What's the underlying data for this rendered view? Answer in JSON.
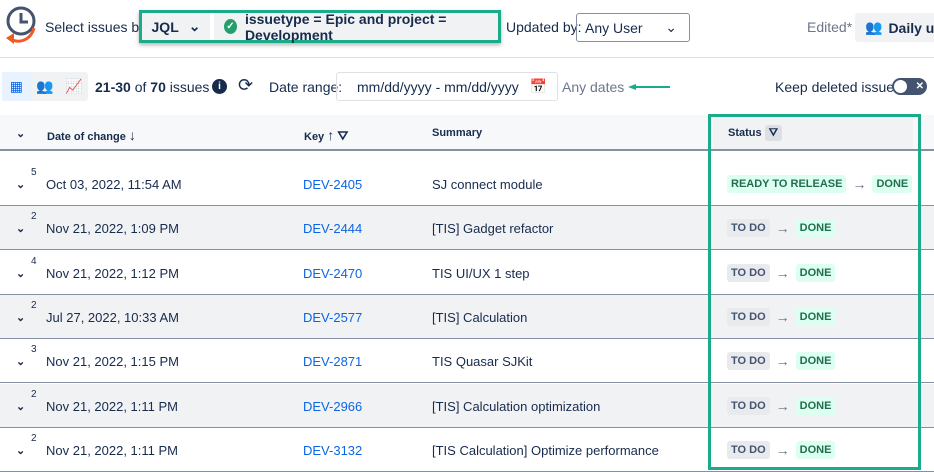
{
  "header": {
    "select_label": "Select issues by:",
    "mode": "JQL",
    "query": "issuetype = Epic and project = Development",
    "updated_by_label": "Updated by:",
    "updated_by_value": "Any User",
    "edited": "Edited*",
    "view_name": "Daily updates"
  },
  "toolbar": {
    "range": "21-30",
    "of": " of ",
    "total": "70",
    "issues": " issues",
    "date_range_label": "Date range:",
    "date_placeholder": "mm/dd/yyyy - mm/dd/yyyy",
    "any_dates": "Any dates",
    "keep_deleted": "Keep deleted issues"
  },
  "columns": {
    "date": "Date of change",
    "key": "Key",
    "summary": "Summary",
    "status": "Status"
  },
  "rows": [
    {
      "count": "5",
      "date": "Oct 03, 2022, 11:54 AM",
      "key": "DEV-2405",
      "summary": "SJ connect module",
      "from": "READY TO RELEASE",
      "to": "DONE"
    },
    {
      "count": "2",
      "date": "Nov 21, 2022, 1:09 PM",
      "key": "DEV-2444",
      "summary": "[TIS] Gadget refactor",
      "from": "TO DO",
      "to": "DONE"
    },
    {
      "count": "4",
      "date": "Nov 21, 2022, 1:12 PM",
      "key": "DEV-2470",
      "summary": "TIS UI/UX 1 step",
      "from": "TO DO",
      "to": "DONE"
    },
    {
      "count": "2",
      "date": "Jul 27, 2022, 10:33 AM",
      "key": "DEV-2577",
      "summary": "[TIS] Calculation",
      "from": "TO DO",
      "to": "DONE"
    },
    {
      "count": "3",
      "date": "Nov 21, 2022, 1:15 PM",
      "key": "DEV-2871",
      "summary": "TIS Quasar SJKit",
      "from": "TO DO",
      "to": "DONE"
    },
    {
      "count": "2",
      "date": "Nov 21, 2022, 1:11 PM",
      "key": "DEV-2966",
      "summary": "[TIS] Calculation optimization",
      "from": "TO DO",
      "to": "DONE"
    },
    {
      "count": "2",
      "date": "Nov 21, 2022, 1:11 PM",
      "key": "DEV-3132",
      "summary": "[TIS Calculation] Optimize performance",
      "from": "TO DO",
      "to": "DONE"
    }
  ]
}
